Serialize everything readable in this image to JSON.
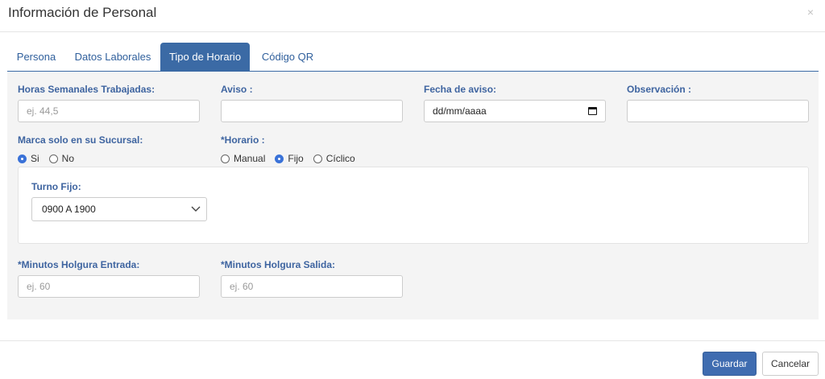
{
  "modal": {
    "title": "Información de Personal",
    "close_glyph": "×"
  },
  "tabs": [
    {
      "label": "Persona",
      "active": false
    },
    {
      "label": "Datos Laborales",
      "active": false
    },
    {
      "label": "Tipo de Horario",
      "active": true
    },
    {
      "label": "Código QR",
      "active": false
    }
  ],
  "form": {
    "horas": {
      "label": "Horas Semanales Trabajadas:",
      "placeholder": "ej. 44,5",
      "value": ""
    },
    "aviso": {
      "label": "Aviso :",
      "value": ""
    },
    "fecha_aviso": {
      "label": "Fecha de aviso:",
      "placeholder": "dd/mm/aaaa"
    },
    "observacion": {
      "label": "Observación :",
      "value": ""
    },
    "marca": {
      "label": "Marca solo en su Sucursal:",
      "options": [
        "Si",
        "No"
      ],
      "selected": "Si"
    },
    "horario": {
      "label": "*Horario :",
      "options": [
        "Manual",
        "Fijo",
        "Cíclico"
      ],
      "selected": "Fijo"
    },
    "turno_fijo": {
      "label": "Turno Fijo:",
      "selected": "0900 A 1900"
    },
    "holgura_entrada": {
      "label": "*Minutos Holgura Entrada:",
      "placeholder": "ej. 60",
      "value": ""
    },
    "holgura_salida": {
      "label": "*Minutos Holgura Salida:",
      "placeholder": "ej. 60",
      "value": ""
    }
  },
  "footer": {
    "save_label": "Guardar",
    "cancel_label": "Cancelar"
  },
  "colors": {
    "primary": "#3b6aa5",
    "label_blue": "#3e64a0",
    "radio_selected": "#3a72d8"
  }
}
